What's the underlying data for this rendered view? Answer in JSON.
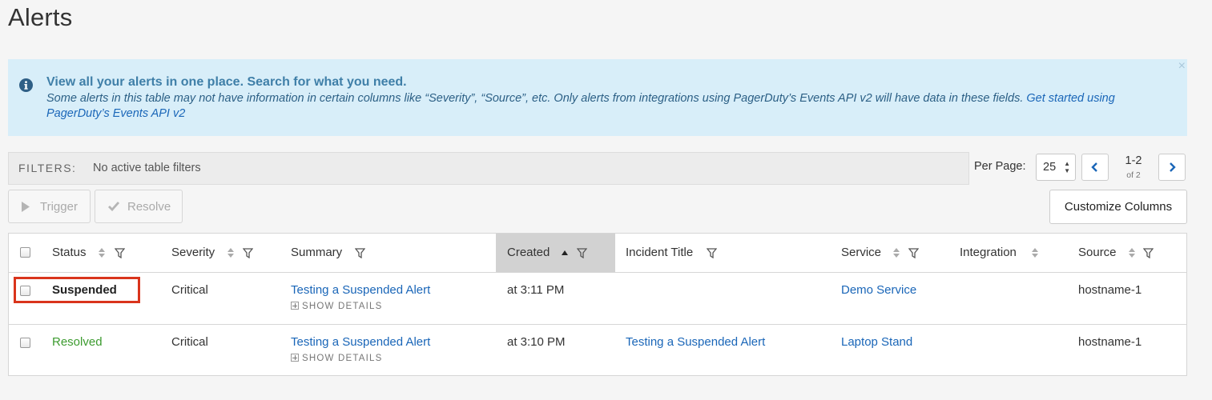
{
  "page": {
    "title": "Alerts"
  },
  "banner": {
    "headline": "View all your alerts in one place. Search for what you need.",
    "body": "Some alerts in this table may not have information in certain columns like “Severity”, “Source”, etc. Only alerts from integrations using PagerDuty’s Events API v2 will have data in these fields.",
    "link": "Get started using PagerDuty’s Events API v2",
    "close": "×",
    "colors": {
      "background": "#d8eef9",
      "headline": "#3f7fa8"
    }
  },
  "filters": {
    "label": "FILTERS:",
    "value": "No active table filters"
  },
  "pagination": {
    "per_page_label": "Per Page:",
    "per_page_value": "25",
    "range": "1-2",
    "of": "of 2"
  },
  "actions": {
    "trigger": "Trigger",
    "resolve": "Resolve",
    "customize": "Customize Columns"
  },
  "table": {
    "columns": {
      "status": "Status",
      "severity": "Severity",
      "summary": "Summary",
      "created": "Created",
      "incident_title": "Incident Title",
      "service": "Service",
      "integration": "Integration",
      "source": "Source"
    },
    "sorted_column": "Created",
    "sort_direction": "ascending",
    "rows": [
      {
        "status": "Suspended",
        "severity": "Critical",
        "summary": "Testing a Suspended Alert",
        "details": "SHOW DETAILS",
        "created": "at 3:11 PM",
        "incident_title": "",
        "service": "Demo Service",
        "integration": "",
        "source": "hostname-1"
      },
      {
        "status": "Resolved",
        "severity": "Critical",
        "summary": "Testing a Suspended Alert",
        "details": "SHOW DETAILS",
        "created": "at 3:10 PM",
        "incident_title": "Testing a Suspended Alert",
        "service": "Laptop Stand",
        "integration": "",
        "source": "hostname-1"
      }
    ]
  },
  "colors": {
    "link": "#1a66b8",
    "resolved": "#3c9b2f",
    "highlight": "#d9341c",
    "sorted_header": "#d2d2d2"
  }
}
